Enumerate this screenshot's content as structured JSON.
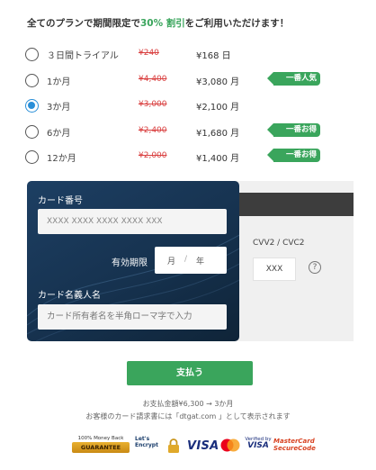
{
  "headline": {
    "prefix": "全てのプランで期間限定で",
    "highlight": "30% 割引",
    "suffix": "をご利用いただけます！"
  },
  "plans": [
    {
      "name": "３日間トライアル",
      "old_price": "¥240",
      "price": "¥168 日",
      "selected": false,
      "badge": ""
    },
    {
      "name": "1か月",
      "old_price": "¥4,400",
      "price": "¥3,080 月",
      "selected": false,
      "badge": "一番人気"
    },
    {
      "name": "3か月",
      "old_price": "¥3,000",
      "price": "¥2,100 月",
      "selected": true,
      "badge": ""
    },
    {
      "name": "6か月",
      "old_price": "¥2,400",
      "price": "¥1,680 月",
      "selected": false,
      "badge": "一番お得"
    },
    {
      "name": "12か月",
      "old_price": "¥2,000",
      "price": "¥1,400 月",
      "selected": false,
      "badge": "一番お得"
    }
  ],
  "card": {
    "number_label": "カード番号",
    "number_placeholder": "XXXX XXXX XXXX XXXX XXX",
    "expiry_label": "有効期限",
    "expiry_month": "月",
    "expiry_sep": "/",
    "expiry_year": "年",
    "name_label": "カード名義人名",
    "name_placeholder": "カード所有者名を半角ローマ字で入力",
    "cvv_label": "CVV2 / CVC2",
    "cvv_placeholder": "XXX",
    "help_symbol": "?"
  },
  "pay_button": "支払う",
  "summary": "お支払金額¥6,300 → 3か月",
  "statement_note": "お客様のカード請求書には「dtgat.com 」として表示されます",
  "trust_badges": {
    "guarantee_top": "100% Money Back",
    "guarantee": "GUARANTEE",
    "letsencrypt_1": "Let's",
    "letsencrypt_2": "Encrypt",
    "visa": "VISA",
    "verified_1": "Verified by",
    "verified_2": "VISA",
    "securecode_1": "MasterCard",
    "securecode_2": "SecureCode"
  },
  "colors": {
    "accent": "#3aa55c",
    "selected": "#2a8fd8",
    "strike": "#d94040",
    "card_bg": "#16324f"
  }
}
